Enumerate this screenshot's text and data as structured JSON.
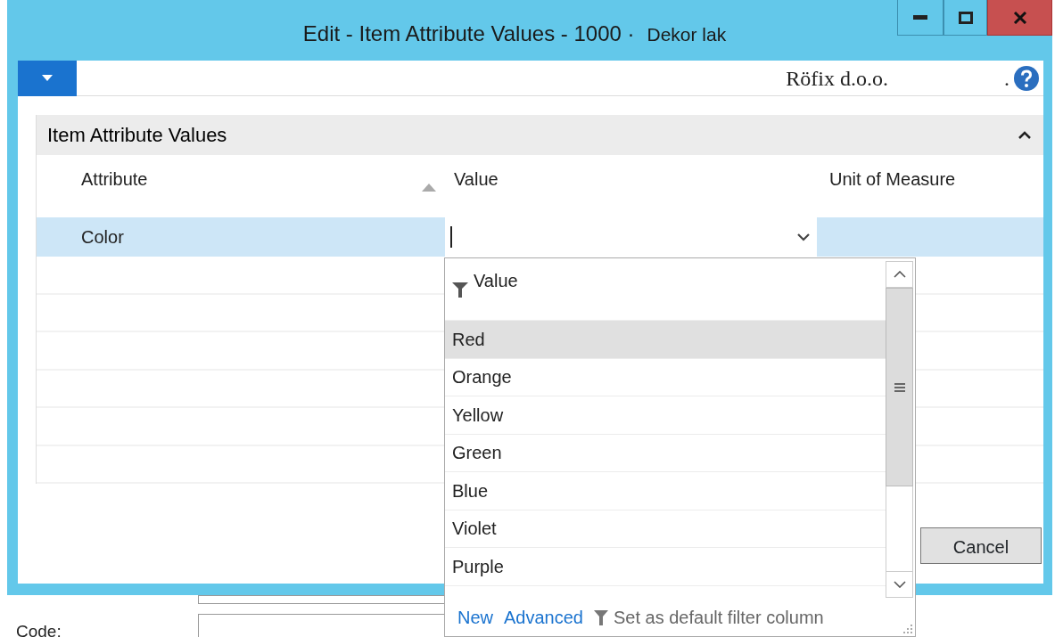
{
  "window": {
    "title": "Edit - Item Attribute Values - 1000 ·",
    "subtitle": "Dekor lak"
  },
  "header": {
    "company": "Röfix d.o.o.",
    "suffix": "."
  },
  "group": {
    "title": "Item Attribute Values",
    "expanded": true
  },
  "columns": [
    {
      "label": "Attribute",
      "sorted": true
    },
    {
      "label": "Value",
      "sorted": false
    },
    {
      "label": "Unit of Measure",
      "sorted": false
    }
  ],
  "rows": [
    {
      "attribute": "Color",
      "selected": true
    }
  ],
  "lookup": {
    "column": "Value",
    "items": [
      {
        "label": "Red",
        "selected": true
      },
      {
        "label": "Orange",
        "selected": false
      },
      {
        "label": "Yellow",
        "selected": false
      },
      {
        "label": "Green",
        "selected": false
      },
      {
        "label": "Blue",
        "selected": false
      },
      {
        "label": "Violet",
        "selected": false
      },
      {
        "label": "Purple",
        "selected": false
      }
    ],
    "links": [
      "New",
      "Advanced"
    ],
    "note": "Set as default filter column"
  },
  "buttons": [
    "Cancel"
  ],
  "background_form": {
    "label": "Code:"
  }
}
